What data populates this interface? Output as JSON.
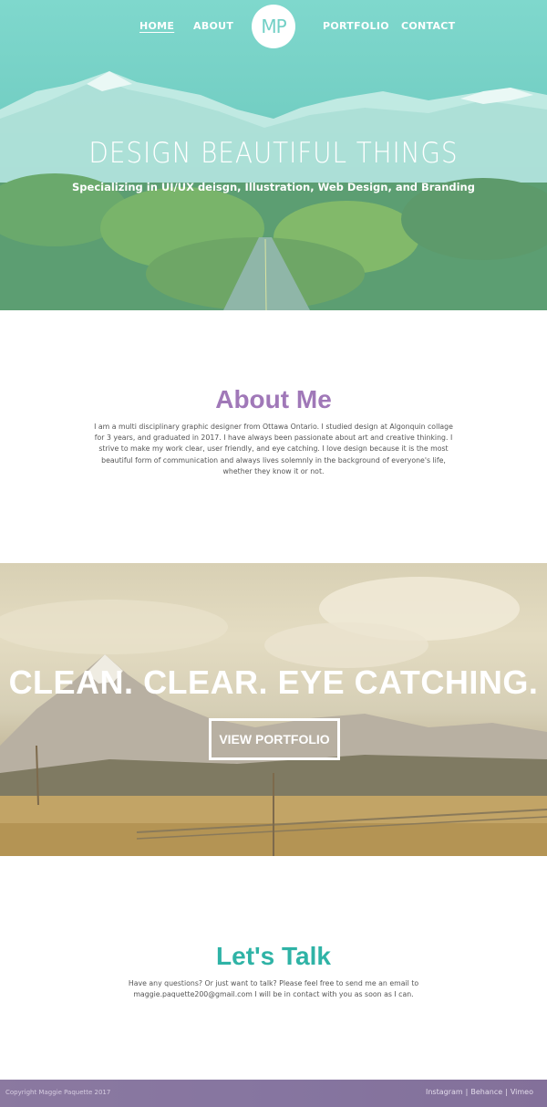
{
  "nav": {
    "home": "HOME",
    "about": "ABOUT",
    "logo": "MP",
    "portfolio": "PORTFOLIO",
    "contact": "CONTACT"
  },
  "hero": {
    "title": "DESIGN BEAUTIFUL THINGS",
    "subtitle": "Specializing in UI/UX deisgn, Illustration, Web Design, and Branding"
  },
  "about": {
    "heading": "About Me",
    "body": "I am a multi disciplinary graphic designer from Ottawa Ontario. I studied design at Algonquin collage for 3 years, and graduated in 2017. I have always been passionate about art and creative thinking. I strive to make my work clear, user friendly, and eye catching. I love design because it is the most beautiful form of communication and always lives solemnly in the background of everyone's life, whether they know it or not."
  },
  "banner": {
    "title": "CLEAN. CLEAR. EYE CATCHING.",
    "button": "VIEW PORTFOLIO"
  },
  "contact": {
    "heading": "Let's Talk",
    "body": "Have any questions? Or just want to talk? Please feel free to send me an email to maggie.paquette200@gmail.com I will be in contact with you as soon as I can."
  },
  "footer": {
    "copyright": "Copyright Maggie Paquette 2017",
    "social": [
      "Instagram",
      "Behance",
      "Vimeo"
    ],
    "separator": "|"
  },
  "colors": {
    "hero_teal": "#74cfc4",
    "about_purple": "#a078b8",
    "contact_teal": "#2fb3a6",
    "footer_purple": "#8474a0"
  }
}
